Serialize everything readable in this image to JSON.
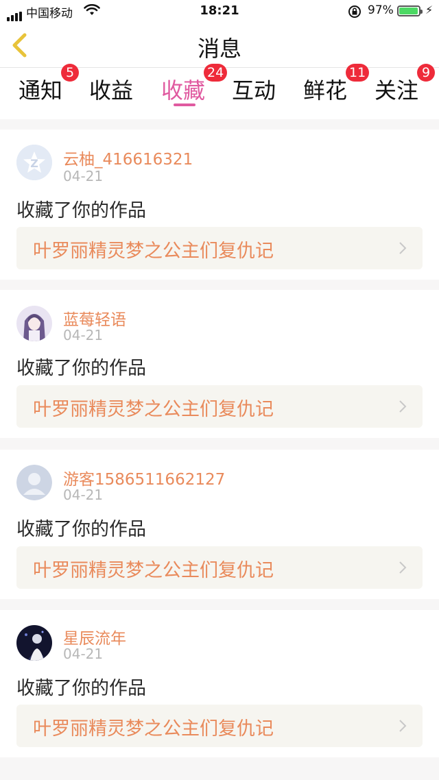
{
  "status_bar": {
    "carrier": "中国移动",
    "time": "18:21",
    "battery_percent": "97%",
    "battery_level": 0.97
  },
  "nav": {
    "title": "消息",
    "back_icon": "chevron-left-icon"
  },
  "tabs": [
    {
      "label": "通知",
      "badge": "5",
      "active": false
    },
    {
      "label": "收益",
      "badge": "",
      "active": false
    },
    {
      "label": "收藏",
      "badge": "24",
      "active": true
    },
    {
      "label": "互动",
      "badge": "",
      "active": false
    },
    {
      "label": "鲜花",
      "badge": "11",
      "active": false
    },
    {
      "label": "关注",
      "badge": "9",
      "active": false
    }
  ],
  "messages": [
    {
      "user": "云柚_416616321",
      "date": "04-21",
      "action": "收藏了你的作品",
      "work_title": "叶罗丽精灵梦之公主们复仇记",
      "avatar": "default-star-avatar"
    },
    {
      "user": "蓝莓轻语",
      "date": "04-21",
      "action": "收藏了你的作品",
      "work_title": "叶罗丽精灵梦之公主们复仇记",
      "avatar": "anime-girl-avatar"
    },
    {
      "user": "游客1586511662127",
      "date": "04-21",
      "action": "收藏了你的作品",
      "work_title": "叶罗丽精灵梦之公主们复仇记",
      "avatar": "guest-avatar"
    },
    {
      "user": "星辰流年",
      "date": "04-21",
      "action": "收藏了你的作品",
      "work_title": "叶罗丽精灵梦之公主们复仇记",
      "avatar": "dark-photo-avatar"
    }
  ],
  "colors": {
    "accent": "#e05aa0",
    "badge": "#ee2b3a",
    "username": "#e98a5b",
    "work_bg": "#f6f5f0",
    "back_icon": "#e8c33a"
  }
}
